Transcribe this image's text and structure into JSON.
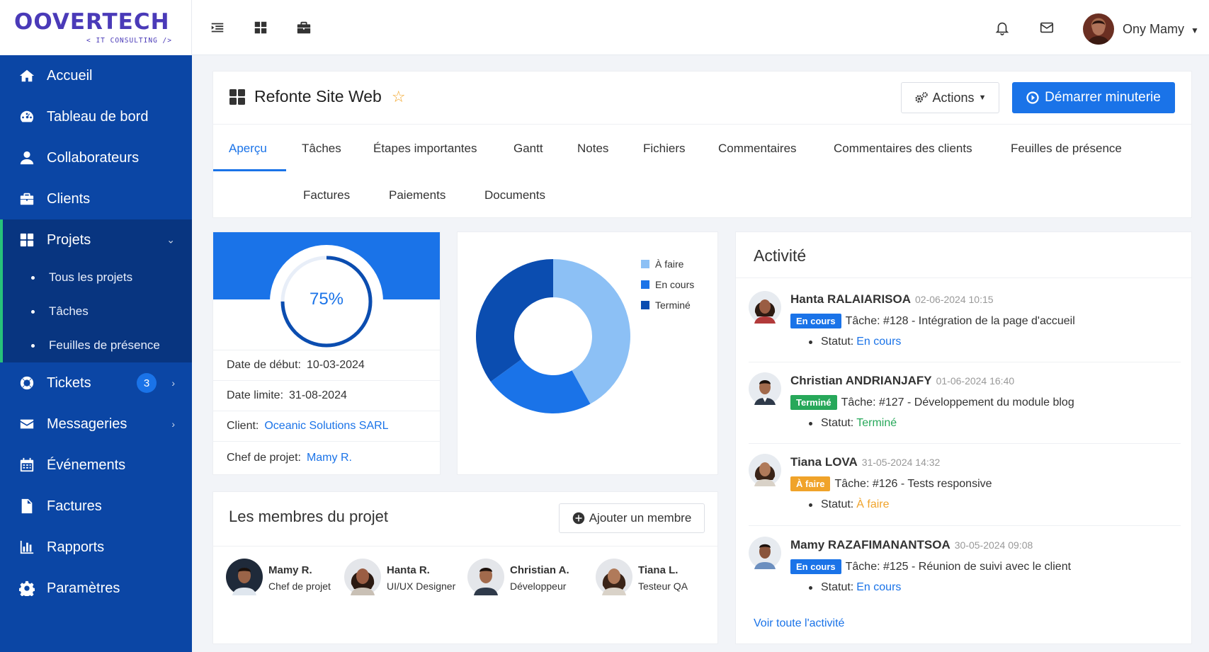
{
  "brand": {
    "name": "OOVERTECH",
    "tagline": "< IT CONSULTING />"
  },
  "sidebar": {
    "items": [
      {
        "label": "Accueil",
        "icon": "home-icon"
      },
      {
        "label": "Tableau de bord",
        "icon": "dashboard-icon"
      },
      {
        "label": "Collaborateurs",
        "icon": "user-icon"
      },
      {
        "label": "Clients",
        "icon": "briefcase-icon"
      },
      {
        "label": "Projets",
        "icon": "grid-icon"
      },
      {
        "label": "Tickets",
        "icon": "lifebuoy-icon",
        "badge": "3"
      },
      {
        "label": "Messageries",
        "icon": "envelope-icon"
      },
      {
        "label": "Événements",
        "icon": "calendar-icon"
      },
      {
        "label": "Factures",
        "icon": "file-icon"
      },
      {
        "label": "Rapports",
        "icon": "bar-chart-icon"
      },
      {
        "label": "Paramètres",
        "icon": "gear-icon"
      }
    ],
    "sub_items": [
      "Tous les projets",
      "Tâches",
      "Feuilles de présence"
    ]
  },
  "topbar": {
    "user_name": "Ony Mamy"
  },
  "project": {
    "title": "Refonte Site Web",
    "actions_label": "Actions",
    "timer_label": "Démarrer minuterie",
    "tabs_row1": [
      "Aperçu",
      "Tâches",
      "Étapes importantes",
      "Gantt",
      "Notes",
      "Fichiers",
      "Commentaires",
      "Commentaires des clients",
      "Feuilles de présence"
    ],
    "tabs_row2": [
      "Factures",
      "Paiements",
      "Documents"
    ]
  },
  "progress": {
    "value_text": "75%",
    "value": 0.75,
    "rows": [
      {
        "label": "Date de début:",
        "value": "10-03-2024"
      },
      {
        "label": "Date limite:",
        "value": "31-08-2024"
      },
      {
        "label": "Client:",
        "value": "Oceanic Solutions SARL"
      },
      {
        "label": "Chef de projet:",
        "value": "Mamy R."
      }
    ]
  },
  "chart_data": {
    "type": "pie",
    "categories": [
      "À faire",
      "En cours",
      "Terminé"
    ],
    "values": [
      42,
      23,
      35
    ],
    "colors": [
      "#8cc0f5",
      "#1a73e8",
      "#0b4db0"
    ],
    "legend": "top-right"
  },
  "activity": {
    "title": "Activité",
    "status_label": "Statut:",
    "see_all": "Voir toute l'activité",
    "items": [
      {
        "name": "Hanta RALAIARISOA",
        "date": "02-06-2024 10:15",
        "badge": "En cours",
        "badge_color": "#1a73e8",
        "task": "Tâche: #128 - Intégration de la page d'accueil",
        "status": "En cours"
      },
      {
        "name": "Christian ANDRIANJAFY",
        "date": "01-06-2024 16:40",
        "badge": "Terminé",
        "badge_color": "#27a85a",
        "task": "Tâche: #127 - Développement du module blog",
        "status": "Terminé"
      },
      {
        "name": "Tiana LOVA",
        "date": "31-05-2024 14:32",
        "badge": "À faire",
        "badge_color": "#f0a32a",
        "task": "Tâche: #126 - Tests responsive",
        "status": "À faire"
      },
      {
        "name": "Mamy RAZAFIMANANTSOA",
        "date": "30-05-2024 09:08",
        "badge": "En cours",
        "badge_color": "#1a73e8",
        "task": "Tâche: #125 - Réunion de suivi avec le client",
        "status": "En cours"
      }
    ]
  },
  "members": {
    "title": "Les membres du projet",
    "add_label": "Ajouter un membre",
    "items": [
      {
        "name": "Mamy R.",
        "role": "Chef de projet"
      },
      {
        "name": "Hanta R.",
        "role": "UI/UX Designer"
      },
      {
        "name": "Christian A.",
        "role": "Développeur"
      },
      {
        "name": "Tiana L.",
        "role": "Testeur QA"
      }
    ]
  }
}
